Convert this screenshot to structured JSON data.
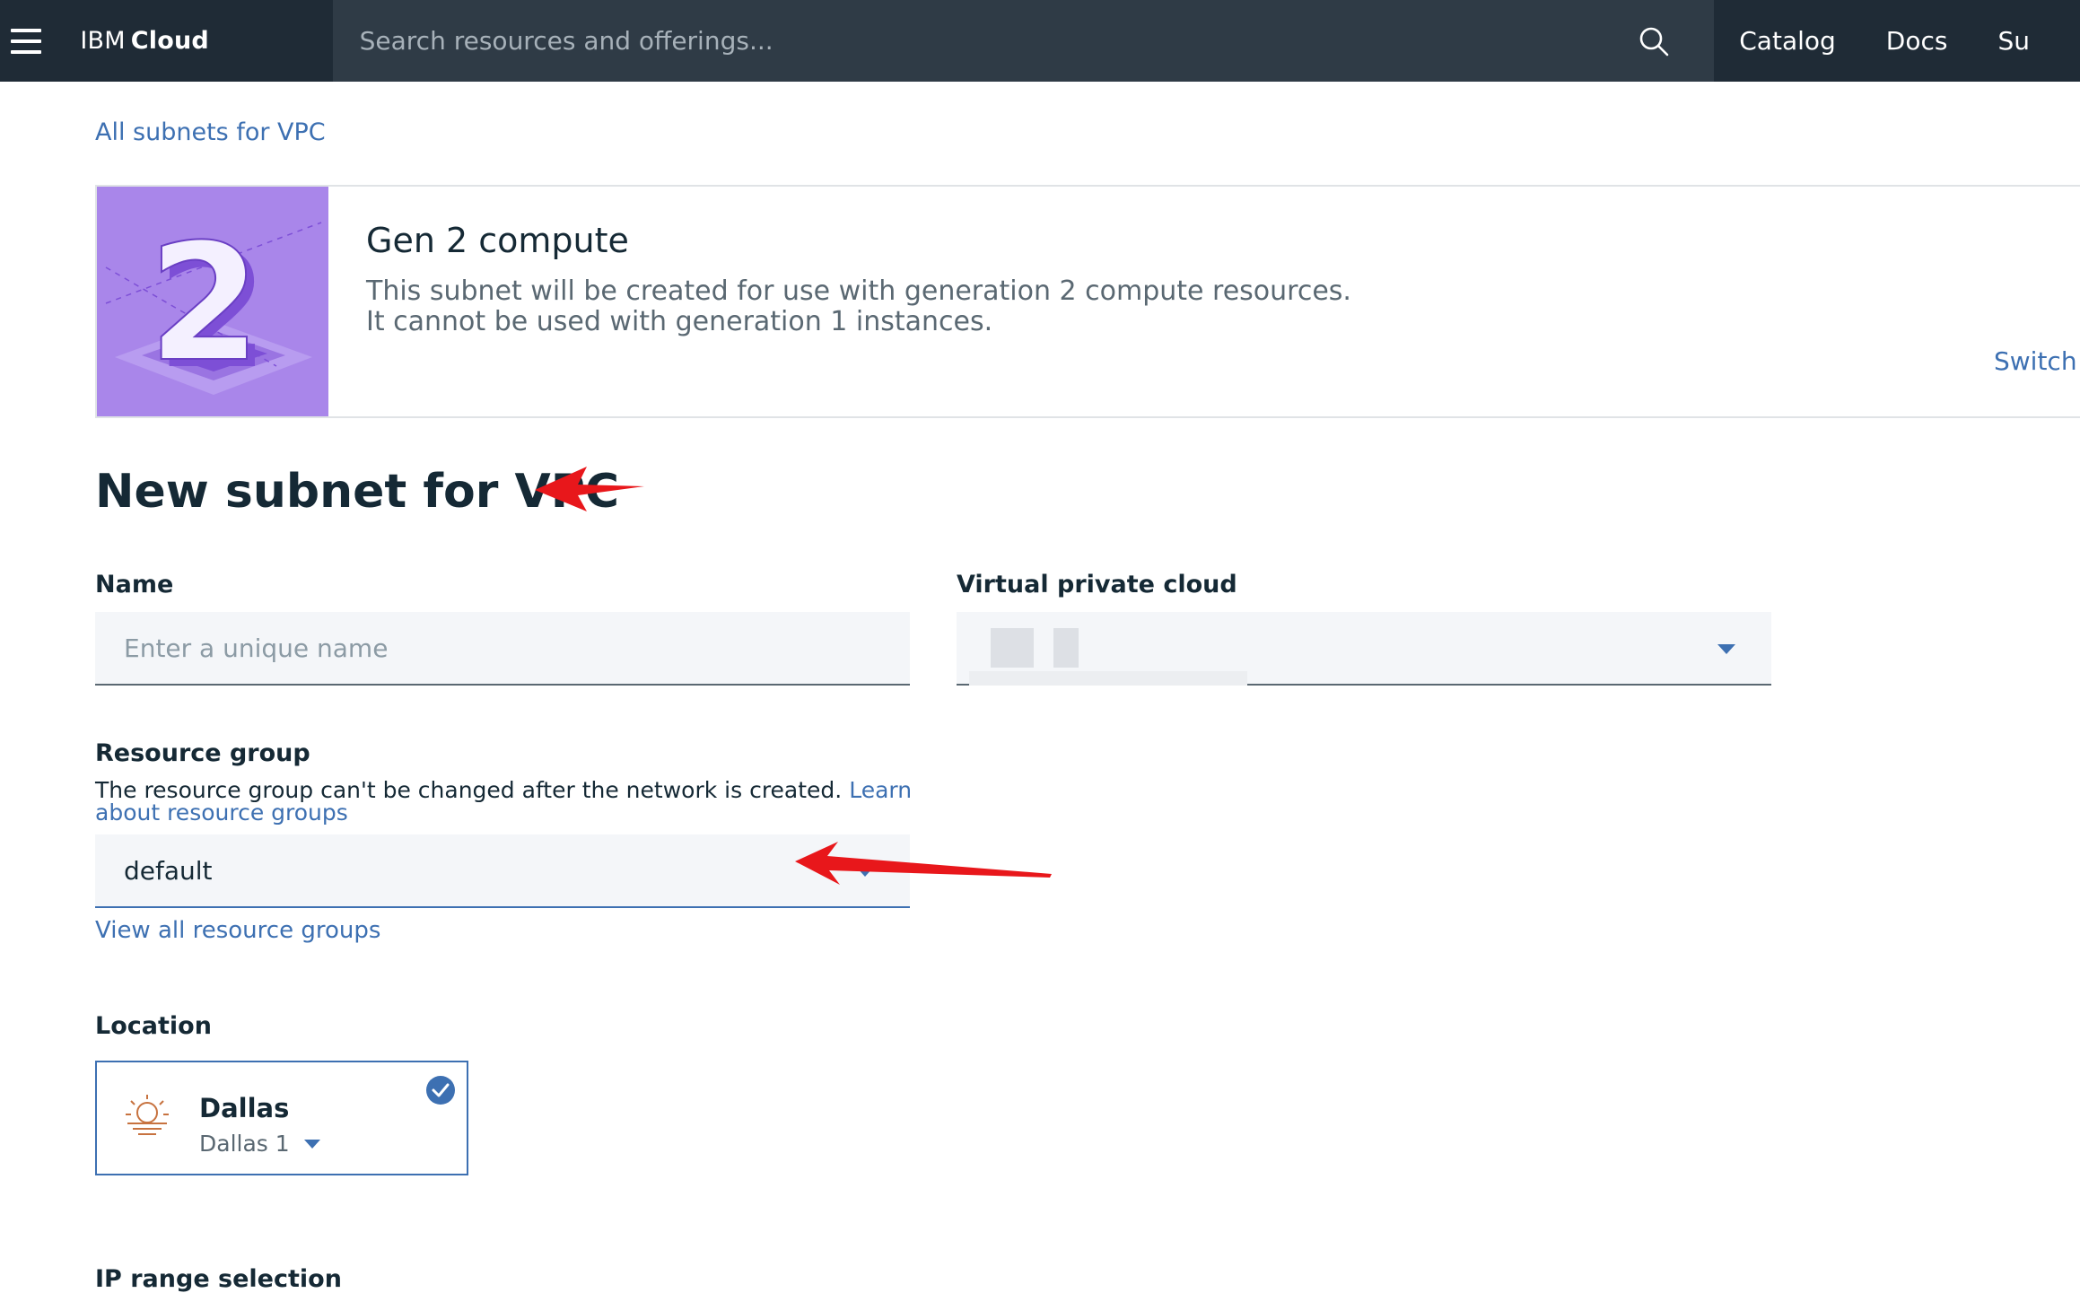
{
  "topbar": {
    "brand_prefix": "IBM",
    "brand_name": "Cloud",
    "search_placeholder": "Search resources and offerings...",
    "nav": [
      "Catalog",
      "Docs",
      "Su"
    ]
  },
  "breadcrumb": "All subnets for VPC",
  "banner": {
    "art_label": "2",
    "title": "Gen 2 compute",
    "description": "This subnet will be created for use with generation 2 compute resources. It cannot be used with generation 1 instances.",
    "link": "Switch t"
  },
  "page_title": "New subnet for VPC",
  "form": {
    "name_label": "Name",
    "name_placeholder": "Enter a unique name",
    "vpc_label": "Virtual private cloud",
    "resource_group_label": "Resource group",
    "resource_group_helper": "The resource group can't be changed after the network is created.",
    "resource_group_learn_link": "Learn about resource groups",
    "resource_group_value": "default",
    "view_all_link": "View all resource groups",
    "location_label": "Location",
    "location_name": "Dallas",
    "location_zone": "Dallas 1",
    "ip_range_label": "IP range selection"
  },
  "colors": {
    "topbar": "#1f2b36",
    "search_bg": "#2f3b46",
    "link": "#3d70b2",
    "banner_art": "#a986ea",
    "annotation_arrow": "#e8171b"
  }
}
